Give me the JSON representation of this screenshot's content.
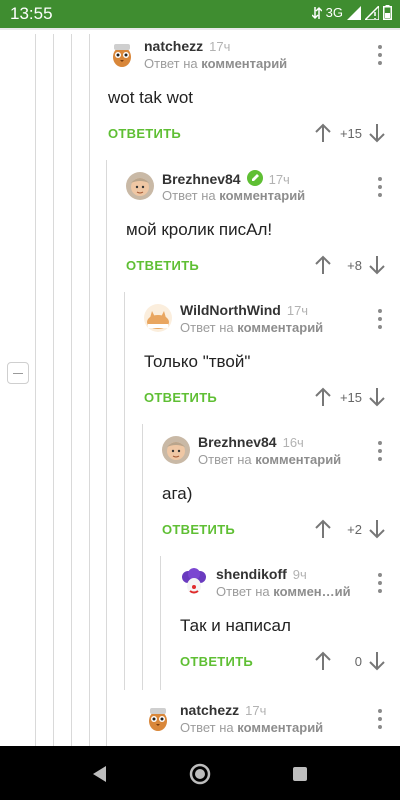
{
  "status_bar": {
    "time": "13:55",
    "network": "3G",
    "icons": [
      "data-sync-icon",
      "signal-icon",
      "wifi-off-signal-icon",
      "battery-icon"
    ]
  },
  "thread": {
    "reply_label": "ОТВЕТИТЬ",
    "comments": [
      {
        "author": "natchezz",
        "time": "17ч",
        "reply_prefix": "Ответ на",
        "reply_target": "комментарий",
        "text": "wot tak wot",
        "score": "+15",
        "avatar": "owl-mascot-avatar"
      },
      {
        "author": "Brezhnev84",
        "time": "17ч",
        "reply_prefix": "Ответ на",
        "reply_target": "комментарий",
        "text": "мой кролик писАл!",
        "score": "+8",
        "avatar": "baby-photo-avatar",
        "verified": true
      },
      {
        "author": "WildNorthWind",
        "time": "17ч",
        "reply_prefix": "Ответ на",
        "reply_target": "комментарий",
        "text": "Только \"твой\"",
        "score": "+15",
        "avatar": "cat-avatar"
      },
      {
        "author": "Brezhnev84",
        "time": "16ч",
        "reply_prefix": "Ответ на",
        "reply_target": "комментарий",
        "text": "ага)",
        "score": "+2",
        "avatar": "baby-photo-avatar"
      },
      {
        "author": "shendikoff",
        "time": "9ч",
        "reply_prefix": "Ответ на",
        "reply_target": "коммен…ий",
        "text": "Так и написал",
        "score": "0",
        "avatar": "clown-avatar"
      },
      {
        "author": "natchezz",
        "time": "17ч",
        "reply_prefix": "Ответ на",
        "reply_target": "комментарий",
        "text": "",
        "score": "",
        "avatar": "owl-mascot-avatar"
      }
    ]
  },
  "colors": {
    "status_bar": "#3f8d30",
    "accent_green": "#5fbf34",
    "nav_bar": "#000000"
  },
  "nav_bar": {
    "buttons": [
      "back-icon",
      "home-icon",
      "recents-icon"
    ]
  }
}
